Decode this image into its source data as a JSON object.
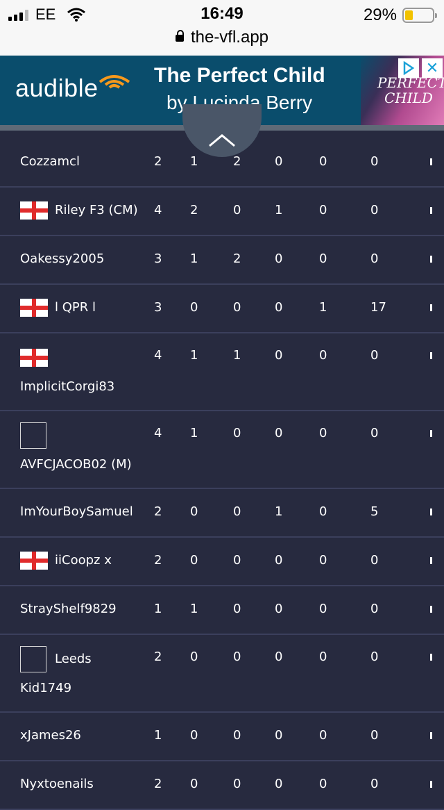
{
  "status_bar": {
    "carrier": "EE",
    "time": "16:49",
    "battery_percent": "29%",
    "battery_level": 0.29,
    "url": "the-vfl.app"
  },
  "ad": {
    "brand": "audible",
    "title": "The Perfect Child",
    "author": "by Lucinda Berry",
    "cover_text_1": "PERFECT",
    "cover_text_2": "CHILD",
    "close_symbol": "✕",
    "brand_color": "#0a4d6c"
  },
  "collapse_icon": "chevron-up-icon",
  "rows": [
    {
      "name": "Cozzamcl",
      "flag": "none",
      "values": [
        "2",
        "1",
        "2",
        "0",
        "0",
        "0"
      ]
    },
    {
      "name": "Riley F3 (CM)",
      "flag": "england",
      "values": [
        "4",
        "2",
        "0",
        "1",
        "0",
        "0"
      ]
    },
    {
      "name": "Oakessy2005",
      "flag": "none",
      "values": [
        "3",
        "1",
        "2",
        "0",
        "0",
        "0"
      ]
    },
    {
      "name": "l QPR l",
      "flag": "england",
      "values": [
        "3",
        "0",
        "0",
        "0",
        "1",
        "17"
      ]
    },
    {
      "name": "ImplicitCorgi83",
      "flag": "england-wrap",
      "values": [
        "4",
        "1",
        "1",
        "0",
        "0",
        "0"
      ]
    },
    {
      "name": "AVFCJACOB02 (M)",
      "flag": "box-wrap",
      "values": [
        "4",
        "1",
        "0",
        "0",
        "0",
        "0"
      ]
    },
    {
      "name": "ImYourBoySamuel",
      "flag": "none",
      "values": [
        "2",
        "0",
        "0",
        "1",
        "0",
        "5"
      ]
    },
    {
      "name": "iiCoopz x",
      "flag": "england",
      "values": [
        "2",
        "0",
        "0",
        "0",
        "0",
        "0"
      ]
    },
    {
      "name": "StrayShelf9829",
      "flag": "none",
      "values": [
        "1",
        "1",
        "0",
        "0",
        "0",
        "0"
      ]
    },
    {
      "name_line1": "Leeds",
      "name_line2": "Kid1749",
      "flag": "box-split",
      "values": [
        "2",
        "0",
        "0",
        "0",
        "0",
        "0"
      ]
    },
    {
      "name": "xJames26",
      "flag": "none",
      "values": [
        "1",
        "0",
        "0",
        "0",
        "0",
        "0"
      ]
    },
    {
      "name": "Nyxtoenails",
      "flag": "none",
      "values": [
        "2",
        "0",
        "0",
        "0",
        "0",
        "0"
      ]
    }
  ]
}
